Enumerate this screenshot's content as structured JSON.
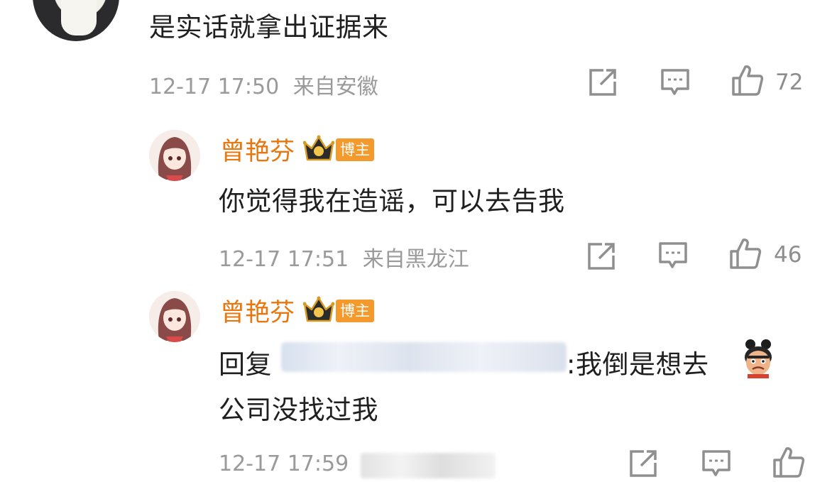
{
  "top_comment": {
    "text": "是实话就拿出证据来",
    "time": "12-17 17:50",
    "location": "来自安徽",
    "like_count": "72"
  },
  "replies": [
    {
      "author": "曾艳芬",
      "badge": "博主",
      "text": "你觉得我在造谣，可以去告我",
      "time": "12-17 17:51",
      "location": "来自黑龙江",
      "like_count": "46"
    },
    {
      "author": "曾艳芬",
      "badge": "博主",
      "reply_prefix": "回复",
      "reply_suffix": ":我倒是想去",
      "text_line2": "公司没找过我",
      "time": "12-17 17:59"
    }
  ],
  "icons": {
    "share": "share-icon",
    "comment": "comment-icon",
    "like": "like-icon",
    "crown": "crown-icon",
    "emoji": "emoji-sticker-icon"
  },
  "colors": {
    "name": "#e8770f",
    "badge": "#f49a2c",
    "meta": "#9a9a9a",
    "text": "#1f1f1f"
  }
}
